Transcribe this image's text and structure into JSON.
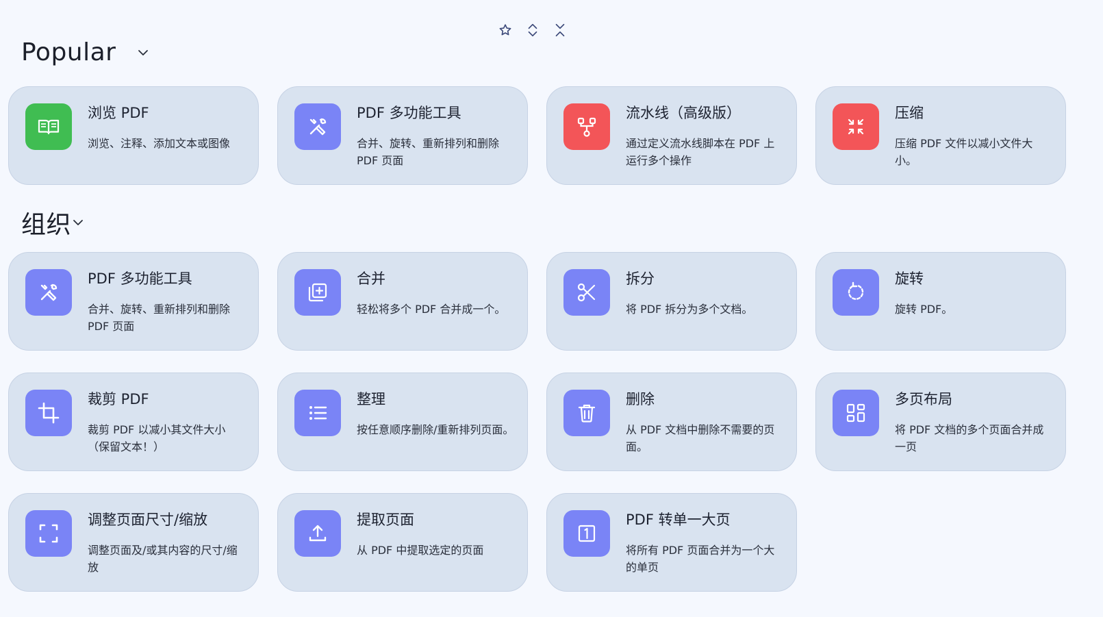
{
  "toolbar": {
    "icons": [
      "star-icon",
      "expand-all-icon",
      "collapse-all-icon"
    ]
  },
  "sections": [
    {
      "title": "Popular"
    },
    {
      "title": "组织"
    }
  ],
  "popular": [
    {
      "title": "浏览 PDF",
      "desc": "浏览、注释、添加文本或图像",
      "icon": "book-icon",
      "color": "#40bd52"
    },
    {
      "title": "PDF 多功能工具",
      "desc": "合并、旋转、重新排列和删除 PDF 页面",
      "icon": "tools-icon",
      "color": "#7a84f6"
    },
    {
      "title": "流水线（高级版）",
      "desc": "通过定义流水线脚本在 PDF 上运行多个操作",
      "icon": "pipeline-icon",
      "color": "#f35558"
    },
    {
      "title": "压缩",
      "desc": "压缩 PDF 文件以减小文件大小。",
      "icon": "compress-icon",
      "color": "#f35558"
    }
  ],
  "organize": [
    {
      "title": "PDF 多功能工具",
      "desc": "合并、旋转、重新排列和删除 PDF 页面",
      "icon": "tools-icon"
    },
    {
      "title": "合并",
      "desc": "轻松将多个 PDF 合并成一个。",
      "icon": "merge-icon"
    },
    {
      "title": "拆分",
      "desc": "将 PDF 拆分为多个文档。",
      "icon": "scissors-icon"
    },
    {
      "title": "旋转",
      "desc": "旋转 PDF。",
      "icon": "rotate-icon"
    },
    {
      "title": "裁剪 PDF",
      "desc": "裁剪 PDF 以减小其文件大小（保留文本！）",
      "icon": "crop-icon"
    },
    {
      "title": "整理",
      "desc": "按任意顺序删除/重新排列页面。",
      "icon": "list-icon"
    },
    {
      "title": "删除",
      "desc": "从 PDF 文档中删除不需要的页面。",
      "icon": "trash-icon"
    },
    {
      "title": "多页布局",
      "desc": "将 PDF 文档的多个页面合并成一页",
      "icon": "grid-icon"
    },
    {
      "title": "调整页面尺寸/缩放",
      "desc": "调整页面及/或其内容的尺寸/缩放",
      "icon": "scale-icon"
    },
    {
      "title": "提取页面",
      "desc": "从 PDF 中提取选定的页面",
      "icon": "upload-icon"
    },
    {
      "title": "PDF 转单一大页",
      "desc": "将所有 PDF 页面合并为一个大的单页",
      "icon": "single-page-icon"
    }
  ]
}
